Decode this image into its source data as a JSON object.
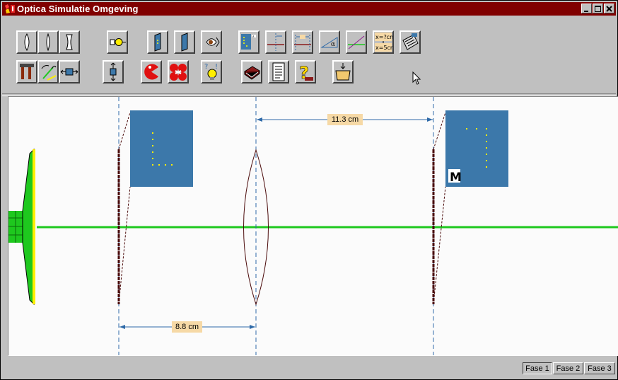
{
  "window": {
    "title": "Optica Simulatie Omgeving",
    "title_bar_color": "#800000"
  },
  "toolbar": {
    "row1": [
      {
        "name": "convex-lens-icon"
      },
      {
        "name": "convex-lens-thin-icon"
      },
      {
        "name": "concave-lens-icon"
      },
      {
        "name": "lamp-icon"
      },
      {
        "name": "screen-icon"
      },
      {
        "name": "screen-plain-icon"
      },
      {
        "name": "eye-icon"
      },
      {
        "name": "object-grid-icon"
      },
      {
        "name": "focal-distance-icon"
      },
      {
        "name": "measure-distance-icon"
      },
      {
        "name": "angle-icon"
      },
      {
        "name": "ray-line-icon"
      },
      {
        "name": "calculate-x-icon",
        "text_top": "x=?cm",
        "text_bottom": "x=5cm"
      },
      {
        "name": "calculator-icon"
      }
    ],
    "row2": [
      {
        "name": "tools-icon"
      },
      {
        "name": "rotate-icon"
      },
      {
        "name": "move-horizontal-icon"
      },
      {
        "name": "move-vertical-icon"
      },
      {
        "name": "eater-icon"
      },
      {
        "name": "split-icon"
      },
      {
        "name": "hint-bulb-icon"
      },
      {
        "name": "book-icon"
      },
      {
        "name": "document-icon"
      },
      {
        "name": "help-icon"
      },
      {
        "name": "open-folder-icon"
      }
    ]
  },
  "canvas": {
    "background": "#fbfbfb",
    "axis_color": "#1ec81e",
    "dim_color": "#2f6aa8",
    "object_box_color": "#3c78aa",
    "measurement_top": "11.3 cm",
    "measurement_bottom": "8.8 cm",
    "image_marker": "M"
  },
  "status": {
    "fase1": "Fase 1",
    "fase2": "Fase 2",
    "fase3": "Fase 3"
  }
}
